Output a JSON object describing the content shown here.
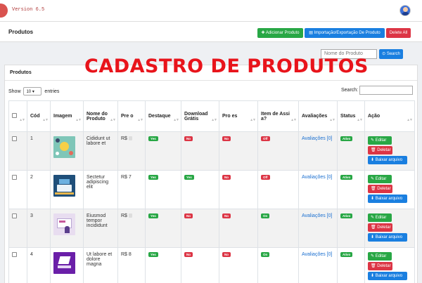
{
  "app": {
    "version": "Version 6.5"
  },
  "header": {
    "title": "Produtos",
    "buttons": {
      "add": "Adicionar Produto",
      "import_export": "Importação/Exportação De Produto",
      "delete_all": "Delete All"
    }
  },
  "search": {
    "placeholder": "Nome do Produto",
    "button": "Search"
  },
  "banner": "CADASTRO DE PRODUTOS",
  "card": {
    "title": "Produtos",
    "show_label": "Show",
    "show_value": "10",
    "entries_label": "entries",
    "search_label": "Search:"
  },
  "table": {
    "columns": {
      "cod": "Cód",
      "imagem": "Imagem",
      "nome": "Nome do Produto",
      "preco": "Pre o",
      "destaque": "Destaque",
      "download": "Download Grátis",
      "promocoes": "Pro es",
      "assinatura": "Item de Assi a?",
      "avaliacoes": "Avaliações",
      "status": "Status",
      "acao": "Ação"
    },
    "rows": [
      {
        "cod": "1",
        "nome": "Cididunt ut labore et",
        "preco": "R$",
        "destaque": "Yes",
        "download": "No",
        "promocoes": "No",
        "assinatura": "Off",
        "avaliacoes": "Avaliações [0]",
        "status": "Ativo"
      },
      {
        "cod": "2",
        "nome": "Sectetur adipiscing elit",
        "preco": "R$ 7",
        "destaque": "Yes",
        "download": "Yes",
        "promocoes": "No",
        "assinatura": "Off",
        "avaliacoes": "Avaliações [0]",
        "status": "Ativo"
      },
      {
        "cod": "3",
        "nome": "Eiusmod tempor incididunt",
        "preco": "R$",
        "destaque": "Yes",
        "download": "No",
        "promocoes": "No",
        "assinatura": "On",
        "avaliacoes": "Avaliações [0]",
        "status": "Ativo"
      },
      {
        "cod": "4",
        "nome": "Ut labore et dolore magna",
        "preco": "R$ 8",
        "destaque": "Yes",
        "download": "No",
        "promocoes": "No",
        "assinatura": "On",
        "avaliacoes": "Avaliações [0]",
        "status": "Ativo"
      }
    ],
    "actions": {
      "edit": "Editar",
      "delete": "Deletar",
      "download": "Baixar arquivo"
    }
  },
  "colors": {
    "green": "#28a745",
    "red": "#dc3545",
    "blue": "#1a7fe0",
    "banner": "#e8141b"
  },
  "icons": [
    "plus-icon",
    "file-icon",
    "search-icon",
    "edit-icon",
    "trash-icon",
    "download-icon",
    "sort-icon",
    "avatar-icon"
  ]
}
